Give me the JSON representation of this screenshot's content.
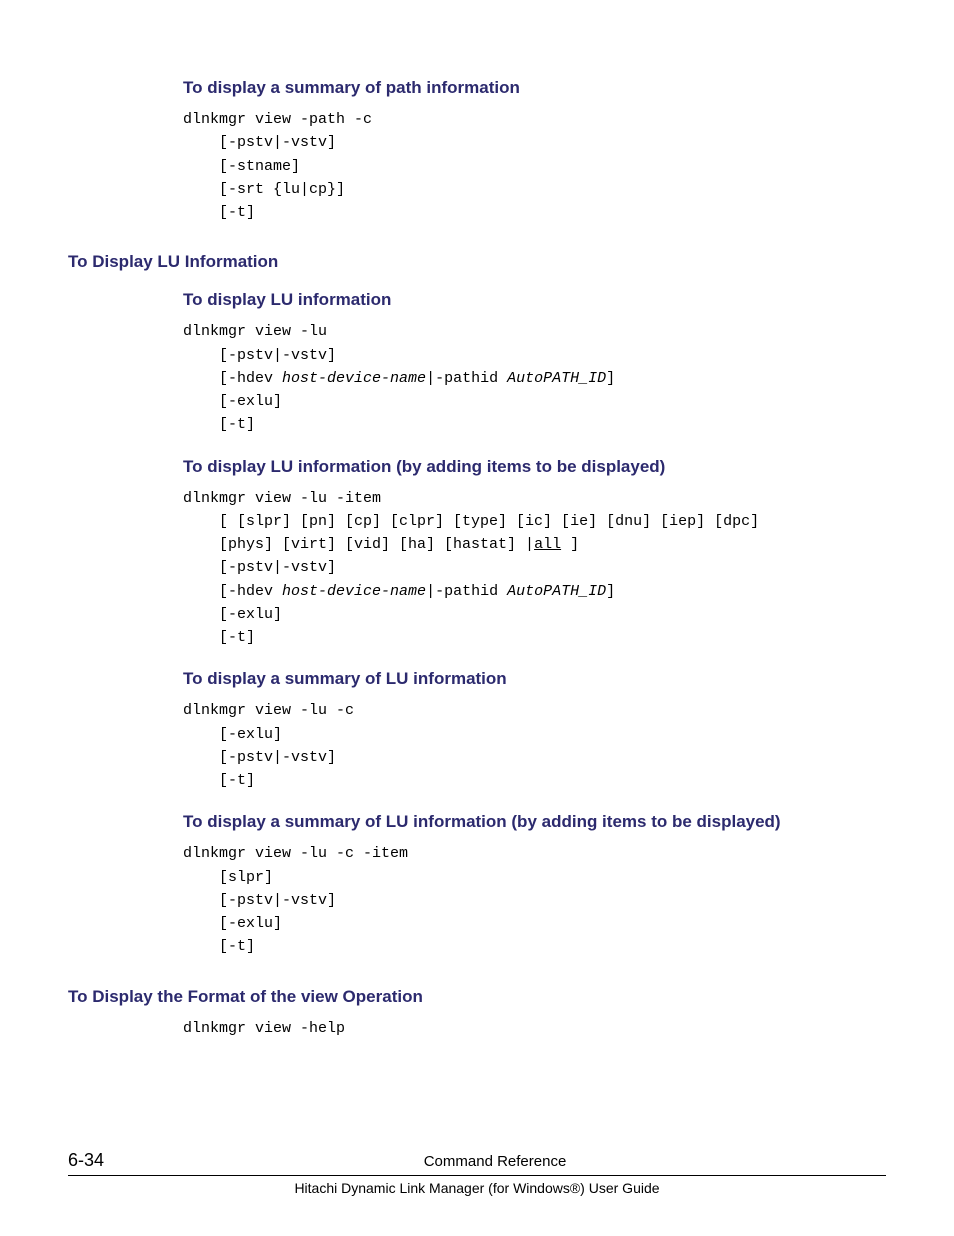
{
  "sections": {
    "s1_title": "To display a summary of path information",
    "s1_code_l1": "dlnkmgr view -path -c",
    "s1_code_l2": "    [-pstv|-vstv]",
    "s1_code_l3": "    [-stname]",
    "s1_code_l4": "    [-srt {lu|cp}]",
    "s1_code_l5": "    [-t]",
    "h2_lu": "To Display LU Information",
    "s2_title": "To display LU information",
    "s2_code_l1": "dlnkmgr view -lu",
    "s2_code_l2": "    [-pstv|-vstv]",
    "s2_code_l3a": "    [-hdev ",
    "s2_code_l3b": "host-device-name",
    "s2_code_l3c": "|-pathid ",
    "s2_code_l3d": "AutoPATH_ID",
    "s2_code_l3e": "]",
    "s2_code_l4": "    [-exlu]",
    "s2_code_l5": "    [-t]",
    "s3_title": "To display LU information (by adding items to be displayed)",
    "s3_code_l1": "dlnkmgr view -lu -item",
    "s3_code_l2": "    [ [slpr] [pn] [cp] [clpr] [type] [ic] [ie] [dnu] [iep] [dpc]",
    "s3_code_l3a": "    [phys] [virt] [vid] [ha] [hastat] |",
    "s3_code_l3b": "all",
    "s3_code_l3c": " ]",
    "s3_code_l4": "    [-pstv|-vstv]",
    "s3_code_l5a": "    [-hdev ",
    "s3_code_l5b": "host-device-name",
    "s3_code_l5c": "|-pathid ",
    "s3_code_l5d": "AutoPATH_ID",
    "s3_code_l5e": "]",
    "s3_code_l6": "    [-exlu]",
    "s3_code_l7": "    [-t]",
    "s4_title": "To display a summary of LU information",
    "s4_code_l1": "dlnkmgr view -lu -c",
    "s4_code_l2": "    [-exlu]",
    "s4_code_l3": "    [-pstv|-vstv]",
    "s4_code_l4": "    [-t]",
    "s5_title": "To display a summary of LU information (by adding items to be displayed)",
    "s5_code_l1": "dlnkmgr view -lu -c -item",
    "s5_code_l2": "    [slpr]",
    "s5_code_l3": "    [-pstv|-vstv]",
    "s5_code_l4": "    [-exlu]",
    "s5_code_l5": "    [-t]",
    "h2_format": "To Display the Format of the view Operation",
    "s6_code": "dlnkmgr view -help"
  },
  "footer": {
    "page": "6-34",
    "chapter": "Command Reference",
    "guide": "Hitachi Dynamic Link Manager (for Windows®) User Guide"
  }
}
